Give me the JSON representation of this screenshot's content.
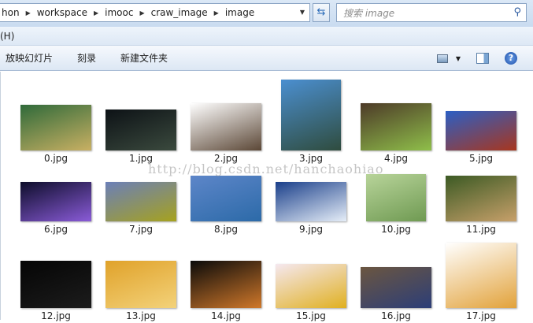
{
  "address": {
    "segments": [
      "hon",
      "workspace",
      "imooc",
      "craw_image",
      "image"
    ]
  },
  "search": {
    "placeholder": "搜索 image"
  },
  "menu": {
    "help": "(H)"
  },
  "toolbar": {
    "slideshow": "放映幻灯片",
    "burn": "刻录",
    "new_folder": "新建文件夹"
  },
  "files": [
    {
      "name": "0.jpg",
      "c": "#2f6a3a,#c9b063",
      "w": 90,
      "h": 58
    },
    {
      "name": "1.jpg",
      "c": "#0d1216,#3b4a3e",
      "w": 90,
      "h": 52
    },
    {
      "name": "2.jpg",
      "c": "#fff,#5b4736",
      "w": 90,
      "h": 60
    },
    {
      "name": "3.jpg",
      "c": "#4b8fd0,#2f4c3e",
      "w": 76,
      "h": 90
    },
    {
      "name": "4.jpg",
      "c": "#4d3a28,#8fbf4a",
      "w": 90,
      "h": 60
    },
    {
      "name": "5.jpg",
      "c": "#2c5fc4,#a8361e",
      "w": 90,
      "h": 50
    },
    {
      "name": "6.jpg",
      "c": "#0d0d2a,#8a5bd8",
      "w": 90,
      "h": 50
    },
    {
      "name": "7.jpg",
      "c": "#6b7fb8,#a6a21e",
      "w": 90,
      "h": 50
    },
    {
      "name": "8.jpg",
      "c": "#5d86c9,#2c6aa8",
      "w": 90,
      "h": 58
    },
    {
      "name": "9.jpg",
      "c": "#1a3f8a,#e6eef8",
      "w": 90,
      "h": 50
    },
    {
      "name": "10.jpg",
      "c": "#b8d49a,#6f9a52",
      "w": 76,
      "h": 60
    },
    {
      "name": "11.jpg",
      "c": "#3c5a24,#c7a06a",
      "w": 90,
      "h": 58
    },
    {
      "name": "12.jpg",
      "c": "#050505,#1c1c1c",
      "w": 90,
      "h": 60
    },
    {
      "name": "13.jpg",
      "c": "#e0a22a,#f3d27a",
      "w": 90,
      "h": 60
    },
    {
      "name": "14.jpg",
      "c": "#0a0a0a,#d0782a",
      "w": 90,
      "h": 60
    },
    {
      "name": "15.jpg",
      "c": "#f5e8f0,#e0b020",
      "w": 90,
      "h": 56
    },
    {
      "name": "16.jpg",
      "c": "#6b5640,#2c3e78",
      "w": 90,
      "h": 52
    },
    {
      "name": "17.jpg",
      "c": "#ffffff,#e2a23a",
      "w": 90,
      "h": 83
    }
  ],
  "watermark": "http://blog.csdn.net/hanchaohiao"
}
